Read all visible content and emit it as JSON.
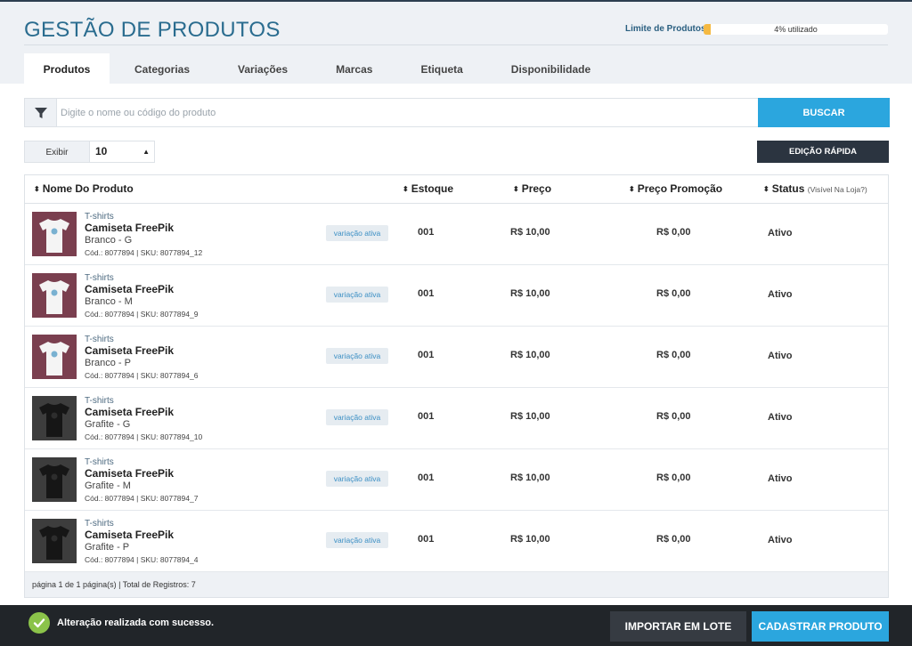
{
  "header": {
    "title": "GESTÃO DE PRODUTOS",
    "limit_label": "Limite de Produtos",
    "limit_text": "4% utilizado",
    "limit_fraction": 0.04
  },
  "tabs": [
    {
      "label": "Produtos",
      "active": true
    },
    {
      "label": "Categorias",
      "active": false
    },
    {
      "label": "Variações",
      "active": false
    },
    {
      "label": "Marcas",
      "active": false
    },
    {
      "label": "Etiqueta",
      "active": false
    },
    {
      "label": "Disponibilidade",
      "active": false
    }
  ],
  "search": {
    "placeholder": "Digite o nome ou código do produto",
    "value": "",
    "button_label": "BUSCAR"
  },
  "display": {
    "label": "Exibir",
    "value": "10",
    "quick_edit_label": "EDIÇÃO RÁPIDA"
  },
  "table": {
    "columns": {
      "name": "Nome Do Produto",
      "stock": "Estoque",
      "price": "Preço",
      "promo": "Preço Promoção",
      "status": "Status",
      "status_note": "(Visível Na Loja?)"
    },
    "rows": [
      {
        "category": "T-shirts",
        "name": "Camiseta FreePik",
        "variant": "Branco - G",
        "code": "Cód.: 8077894 | SKU: 8077894_12",
        "badge": "variação ativa",
        "stock": "001",
        "price": "R$ 10,00",
        "promo": "R$ 0,00",
        "status": "Ativo",
        "shirt": "white"
      },
      {
        "category": "T-shirts",
        "name": "Camiseta FreePik",
        "variant": "Branco - M",
        "code": "Cód.: 8077894 | SKU: 8077894_9",
        "badge": "variação ativa",
        "stock": "001",
        "price": "R$ 10,00",
        "promo": "R$ 0,00",
        "status": "Ativo",
        "shirt": "white"
      },
      {
        "category": "T-shirts",
        "name": "Camiseta FreePik",
        "variant": "Branco - P",
        "code": "Cód.: 8077894 | SKU: 8077894_6",
        "badge": "variação ativa",
        "stock": "001",
        "price": "R$ 10,00",
        "promo": "R$ 0,00",
        "status": "Ativo",
        "shirt": "white"
      },
      {
        "category": "T-shirts",
        "name": "Camiseta FreePik",
        "variant": "Grafite - G",
        "code": "Cód.: 8077894 | SKU: 8077894_10",
        "badge": "variação ativa",
        "stock": "001",
        "price": "R$ 10,00",
        "promo": "R$ 0,00",
        "status": "Ativo",
        "shirt": "graphite"
      },
      {
        "category": "T-shirts",
        "name": "Camiseta FreePik",
        "variant": "Grafite - M",
        "code": "Cód.: 8077894 | SKU: 8077894_7",
        "badge": "variação ativa",
        "stock": "001",
        "price": "R$ 10,00",
        "promo": "R$ 0,00",
        "status": "Ativo",
        "shirt": "graphite"
      },
      {
        "category": "T-shirts",
        "name": "Camiseta FreePik",
        "variant": "Grafite - P",
        "code": "Cód.: 8077894 | SKU: 8077894_4",
        "badge": "variação ativa",
        "stock": "001",
        "price": "R$ 10,00",
        "promo": "R$ 0,00",
        "status": "Ativo",
        "shirt": "graphite"
      }
    ],
    "footer": "página 1 de 1 página(s) | Total de Registros: 7"
  },
  "bottom": {
    "success_message": "Alteração realizada com sucesso.",
    "import_label": "IMPORTAR EM LOTE",
    "register_label": "CADASTRAR PRODUTO"
  },
  "colors": {
    "accent": "#2ba6de",
    "title": "#2a6c8f",
    "dark_bar": "#212529",
    "success": "#8bc34a",
    "limit_fill": "#f5b942"
  },
  "icons": {
    "filter": "filter-icon",
    "sort": "sort-icon",
    "success": "check-circle-icon",
    "select_arrows": "select-arrows-icon"
  }
}
